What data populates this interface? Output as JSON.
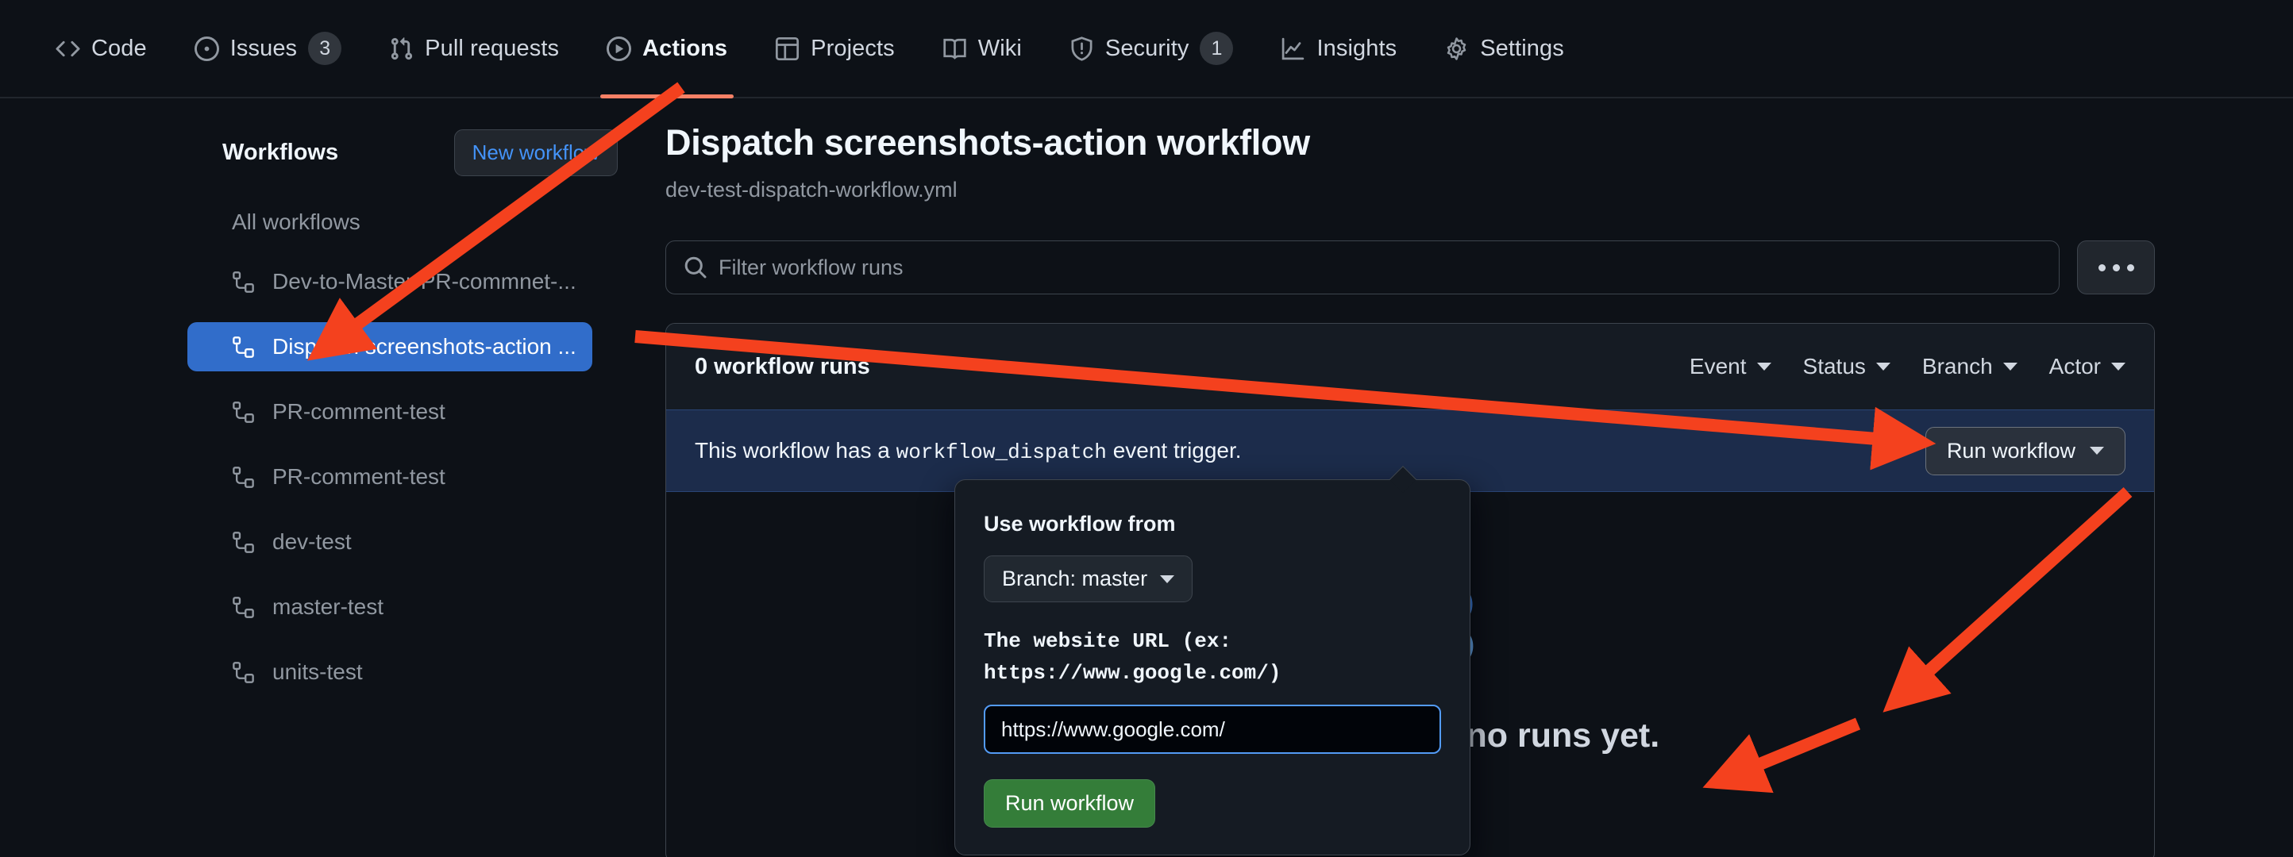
{
  "repo_nav": {
    "items": [
      {
        "label": "Code",
        "icon": "code-icon",
        "badge": null,
        "active": false
      },
      {
        "label": "Issues",
        "icon": "issue-opened-icon",
        "badge": "3",
        "active": false
      },
      {
        "label": "Pull requests",
        "icon": "git-pull-request-icon",
        "badge": null,
        "active": false
      },
      {
        "label": "Actions",
        "icon": "play-circle-icon",
        "badge": null,
        "active": true
      },
      {
        "label": "Projects",
        "icon": "table-icon",
        "badge": null,
        "active": false
      },
      {
        "label": "Wiki",
        "icon": "book-icon",
        "badge": null,
        "active": false
      },
      {
        "label": "Security",
        "icon": "shield-icon",
        "badge": "1",
        "active": false
      },
      {
        "label": "Insights",
        "icon": "graph-icon",
        "badge": null,
        "active": false
      },
      {
        "label": "Settings",
        "icon": "gear-icon",
        "badge": null,
        "active": false
      }
    ],
    "active_underline_color": "#f78166"
  },
  "sidebar": {
    "title": "Workflows",
    "new_workflow_label": "New workflow",
    "all_workflows_label": "All workflows",
    "items": [
      {
        "label": "Dev-to-Master-PR-commnet-...",
        "selected": false
      },
      {
        "label": "Dispatch screenshots-action ...",
        "selected": true
      },
      {
        "label": "PR-comment-test",
        "selected": false
      },
      {
        "label": "PR-comment-test",
        "selected": false
      },
      {
        "label": "dev-test",
        "selected": false
      },
      {
        "label": "master-test",
        "selected": false
      },
      {
        "label": "units-test",
        "selected": false
      }
    ],
    "selected_color": "#316dca"
  },
  "main": {
    "title": "Dispatch screenshots-action workflow",
    "subtitle": "dev-test-dispatch-workflow.yml",
    "search_placeholder": "Filter workflow runs",
    "search_value": "",
    "kebab_label": "...",
    "runs_count": "0 workflow runs",
    "filters": [
      {
        "label": "Event"
      },
      {
        "label": "Status"
      },
      {
        "label": "Branch"
      },
      {
        "label": "Actor"
      }
    ],
    "dispatch_banner": {
      "text_before": "This workflow has a",
      "code": "workflow_dispatch",
      "text_after": "event trigger.",
      "run_button_label": "Run workflow",
      "background": "#1c2c4b"
    },
    "empty_state": {
      "title": "This workflow has no runs yet.",
      "illustration": "workflow-graph-icon",
      "illustration_color": "#4184e4"
    }
  },
  "popover": {
    "use_workflow_from_label": "Use workflow from",
    "branch_button_label": "Branch: master",
    "input_description": "The website URL (ex: https://www.google.com/)",
    "input_value": "https://www.google.com/",
    "submit_label": "Run workflow",
    "submit_color": "#347d39",
    "input_border_color": "#539bf5"
  }
}
